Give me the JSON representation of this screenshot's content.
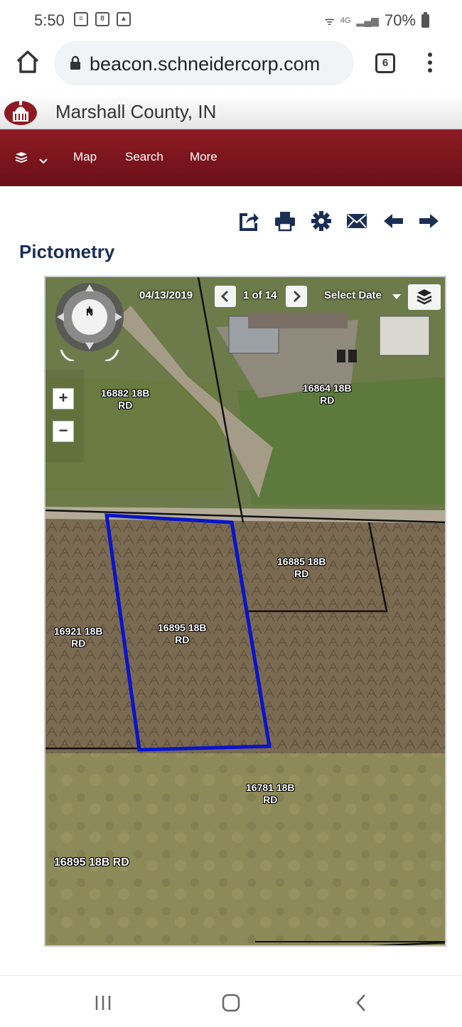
{
  "status_bar": {
    "time": "5:50",
    "notification_icons": [
      "message-icon",
      "calendar-icon",
      "image-icon"
    ],
    "calendar_number": "8",
    "network": "4G",
    "battery": "70%"
  },
  "browser": {
    "url": "beacon.schneidercorp.com",
    "tab_count": "6"
  },
  "site": {
    "title": "Marshall County, IN"
  },
  "nav": {
    "items": [
      "Map",
      "Search",
      "More"
    ]
  },
  "toolbar": {
    "icons": [
      "share-icon",
      "print-icon",
      "settings-icon",
      "email-icon",
      "back-arrow-icon",
      "forward-arrow-icon"
    ]
  },
  "page": {
    "title": "Pictometry"
  },
  "viewer": {
    "date": "04/13/2019",
    "count": "1 of 14",
    "select_date": "Select Date",
    "compass_label": "N",
    "zoom_in": "+",
    "zoom_out": "−",
    "selected_address": "16895 18B RD",
    "parcels": [
      {
        "num": "16882 18B",
        "road": "RD"
      },
      {
        "num": "16864 18B",
        "road": "RD"
      },
      {
        "num": "16885 18B",
        "road": "RD"
      },
      {
        "num": "16921 18B",
        "road": "RD"
      },
      {
        "num": "16895 18B",
        "road": "RD"
      },
      {
        "num": "16781 18B",
        "road": "RD"
      }
    ],
    "colors": {
      "selected_outline": "#0a14c8",
      "parcel_lines": "#111111"
    }
  }
}
